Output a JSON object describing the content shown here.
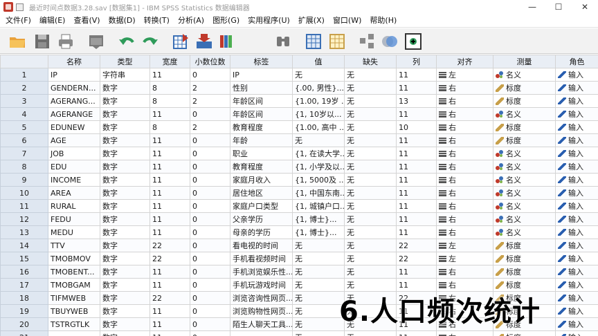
{
  "window": {
    "title": "最近时间点数据3.28.sav [数据集1] - IBM SPSS Statistics 数据编辑器",
    "controls": {
      "minimize": "—",
      "maximize": "☐",
      "close": "✕"
    }
  },
  "menu": [
    "文件(F)",
    "编辑(E)",
    "查看(V)",
    "数据(D)",
    "转换(T)",
    "分析(A)",
    "图形(G)",
    "实用程序(U)",
    "扩展(X)",
    "窗口(W)",
    "帮助(H)"
  ],
  "toolbar": {
    "icons": [
      "open-folder-icon",
      "save-icon",
      "print-icon",
      "dialog-recall-icon",
      "undo-icon",
      "redo-icon",
      "goto-case-icon",
      "goto-variable-icon",
      "variables-icon",
      "find-icon",
      "insert-cases-icon",
      "insert-variable-icon",
      "split-file-icon",
      "value-labels-icon",
      "use-sets-icon"
    ]
  },
  "grid": {
    "columns": [
      "名称",
      "类型",
      "宽度",
      "小数位数",
      "标签",
      "值",
      "缺失",
      "列",
      "对齐",
      "测量",
      "角色"
    ],
    "rows": [
      {
        "num": "1",
        "name": "IP",
        "type": "字符串",
        "width": "11",
        "decimals": "0",
        "label": "IP",
        "values": "无",
        "missing": "无",
        "columns": "11",
        "align": "左",
        "align_icon": "align-left-icon",
        "measure": "名义",
        "measure_icon": "nominal-icon",
        "role": "输入"
      },
      {
        "num": "2",
        "name": "GENDERN...",
        "type": "数字",
        "width": "8",
        "decimals": "2",
        "label": "性别",
        "values": "{.00, 男性}...",
        "missing": "无",
        "columns": "11",
        "align": "右",
        "align_icon": "align-right-icon",
        "measure": "标度",
        "measure_icon": "scale-icon",
        "role": "输入"
      },
      {
        "num": "3",
        "name": "AGERANG...",
        "type": "数字",
        "width": "8",
        "decimals": "2",
        "label": "年龄区间",
        "values": "{1.00, 19岁 ...",
        "missing": "无",
        "columns": "13",
        "align": "右",
        "align_icon": "align-right-icon",
        "measure": "标度",
        "measure_icon": "scale-icon",
        "role": "输入"
      },
      {
        "num": "4",
        "name": "AGERANGE",
        "type": "数字",
        "width": "11",
        "decimals": "0",
        "label": "年龄区间",
        "values": "{1, 10岁以...",
        "missing": "无",
        "columns": "11",
        "align": "右",
        "align_icon": "align-right-icon",
        "measure": "名义",
        "measure_icon": "nominal-icon",
        "role": "输入"
      },
      {
        "num": "5",
        "name": "EDUNEW",
        "type": "数字",
        "width": "8",
        "decimals": "2",
        "label": "教育程度",
        "values": "{1.00, 高中 ...",
        "missing": "无",
        "columns": "10",
        "align": "右",
        "align_icon": "align-right-icon",
        "measure": "标度",
        "measure_icon": "scale-icon",
        "role": "输入"
      },
      {
        "num": "6",
        "name": "AGE",
        "type": "数字",
        "width": "11",
        "decimals": "0",
        "label": "年龄",
        "values": "无",
        "missing": "无",
        "columns": "11",
        "align": "右",
        "align_icon": "align-right-icon",
        "measure": "标度",
        "measure_icon": "scale-icon",
        "role": "输入"
      },
      {
        "num": "7",
        "name": "JOB",
        "type": "数字",
        "width": "11",
        "decimals": "0",
        "label": "职业",
        "values": "{1, 在读大学...",
        "missing": "无",
        "columns": "11",
        "align": "右",
        "align_icon": "align-right-icon",
        "measure": "名义",
        "measure_icon": "nominal-icon",
        "role": "输入"
      },
      {
        "num": "8",
        "name": "EDU",
        "type": "数字",
        "width": "11",
        "decimals": "0",
        "label": "教育程度",
        "values": "{1, 小学及以...",
        "missing": "无",
        "columns": "11",
        "align": "右",
        "align_icon": "align-right-icon",
        "measure": "名义",
        "measure_icon": "nominal-icon",
        "role": "输入"
      },
      {
        "num": "9",
        "name": "INCOME",
        "type": "数字",
        "width": "11",
        "decimals": "0",
        "label": "家庭月收入",
        "values": "{1, 5000及 ...",
        "missing": "无",
        "columns": "11",
        "align": "右",
        "align_icon": "align-right-icon",
        "measure": "名义",
        "measure_icon": "nominal-icon",
        "role": "输入"
      },
      {
        "num": "10",
        "name": "AREA",
        "type": "数字",
        "width": "11",
        "decimals": "0",
        "label": "居住地区",
        "values": "{1, 中国东南...",
        "missing": "无",
        "columns": "11",
        "align": "右",
        "align_icon": "align-right-icon",
        "measure": "名义",
        "measure_icon": "nominal-icon",
        "role": "输入"
      },
      {
        "num": "11",
        "name": "RURAL",
        "type": "数字",
        "width": "11",
        "decimals": "0",
        "label": "家庭户口类型",
        "values": "{1, 城镇户口...",
        "missing": "无",
        "columns": "11",
        "align": "右",
        "align_icon": "align-right-icon",
        "measure": "名义",
        "measure_icon": "nominal-icon",
        "role": "输入"
      },
      {
        "num": "12",
        "name": "FEDU",
        "type": "数字",
        "width": "11",
        "decimals": "0",
        "label": "父亲学历",
        "values": "{1, 博士}...",
        "missing": "无",
        "columns": "11",
        "align": "右",
        "align_icon": "align-right-icon",
        "measure": "名义",
        "measure_icon": "nominal-icon",
        "role": "输入"
      },
      {
        "num": "13",
        "name": "MEDU",
        "type": "数字",
        "width": "11",
        "decimals": "0",
        "label": "母亲的学历",
        "values": "{1, 博士}...",
        "missing": "无",
        "columns": "11",
        "align": "右",
        "align_icon": "align-right-icon",
        "measure": "名义",
        "measure_icon": "nominal-icon",
        "role": "输入"
      },
      {
        "num": "14",
        "name": "TTV",
        "type": "数字",
        "width": "22",
        "decimals": "0",
        "label": "看电视的时间",
        "values": "无",
        "missing": "无",
        "columns": "22",
        "align": "左",
        "align_icon": "align-left-icon",
        "measure": "标度",
        "measure_icon": "scale-icon",
        "role": "输入"
      },
      {
        "num": "15",
        "name": "TMOBMOV",
        "type": "数字",
        "width": "22",
        "decimals": "0",
        "label": "手机看视频时间",
        "values": "无",
        "missing": "无",
        "columns": "22",
        "align": "左",
        "align_icon": "align-left-icon",
        "measure": "标度",
        "measure_icon": "scale-icon",
        "role": "输入"
      },
      {
        "num": "16",
        "name": "TMOBENT...",
        "type": "数字",
        "width": "11",
        "decimals": "0",
        "label": "手机浏览娱乐性...",
        "values": "无",
        "missing": "无",
        "columns": "11",
        "align": "右",
        "align_icon": "align-right-icon",
        "measure": "标度",
        "measure_icon": "scale-icon",
        "role": "输入"
      },
      {
        "num": "17",
        "name": "TMOBGAM",
        "type": "数字",
        "width": "11",
        "decimals": "0",
        "label": "手机玩游戏时间",
        "values": "无",
        "missing": "无",
        "columns": "11",
        "align": "右",
        "align_icon": "align-right-icon",
        "measure": "标度",
        "measure_icon": "scale-icon",
        "role": "输入"
      },
      {
        "num": "18",
        "name": "TIFMWEB",
        "type": "数字",
        "width": "22",
        "decimals": "0",
        "label": "浏览咨询性网页...",
        "values": "无",
        "missing": "无",
        "columns": "22",
        "align": "右",
        "align_icon": "align-right-icon",
        "measure": "标度",
        "measure_icon": "scale-icon",
        "role": "输入"
      },
      {
        "num": "19",
        "name": "TBUYWEB",
        "type": "数字",
        "width": "11",
        "decimals": "0",
        "label": "浏览购物性网页...",
        "values": "无",
        "missing": "无",
        "columns": "11",
        "align": "右",
        "align_icon": "align-right-icon",
        "measure": "标度",
        "measure_icon": "scale-icon",
        "role": "输入"
      },
      {
        "num": "20",
        "name": "TSTRGTLK",
        "type": "数字",
        "width": "11",
        "decimals": "0",
        "label": "陌生人聊天工具...",
        "values": "无",
        "missing": "无",
        "columns": "11",
        "align": "右",
        "align_icon": "align-right-icon",
        "measure": "标度",
        "measure_icon": "scale-icon",
        "role": "输入"
      },
      {
        "num": "21",
        "name": "",
        "type": "数字",
        "width": "11",
        "decimals": "0",
        "label": "",
        "values": "无",
        "missing": "无",
        "columns": "11",
        "align": "右",
        "align_icon": "align-right-icon",
        "measure": "标度",
        "measure_icon": "scale-icon",
        "role": "输入"
      }
    ]
  },
  "overlay_caption": "6.人口频次统计"
}
